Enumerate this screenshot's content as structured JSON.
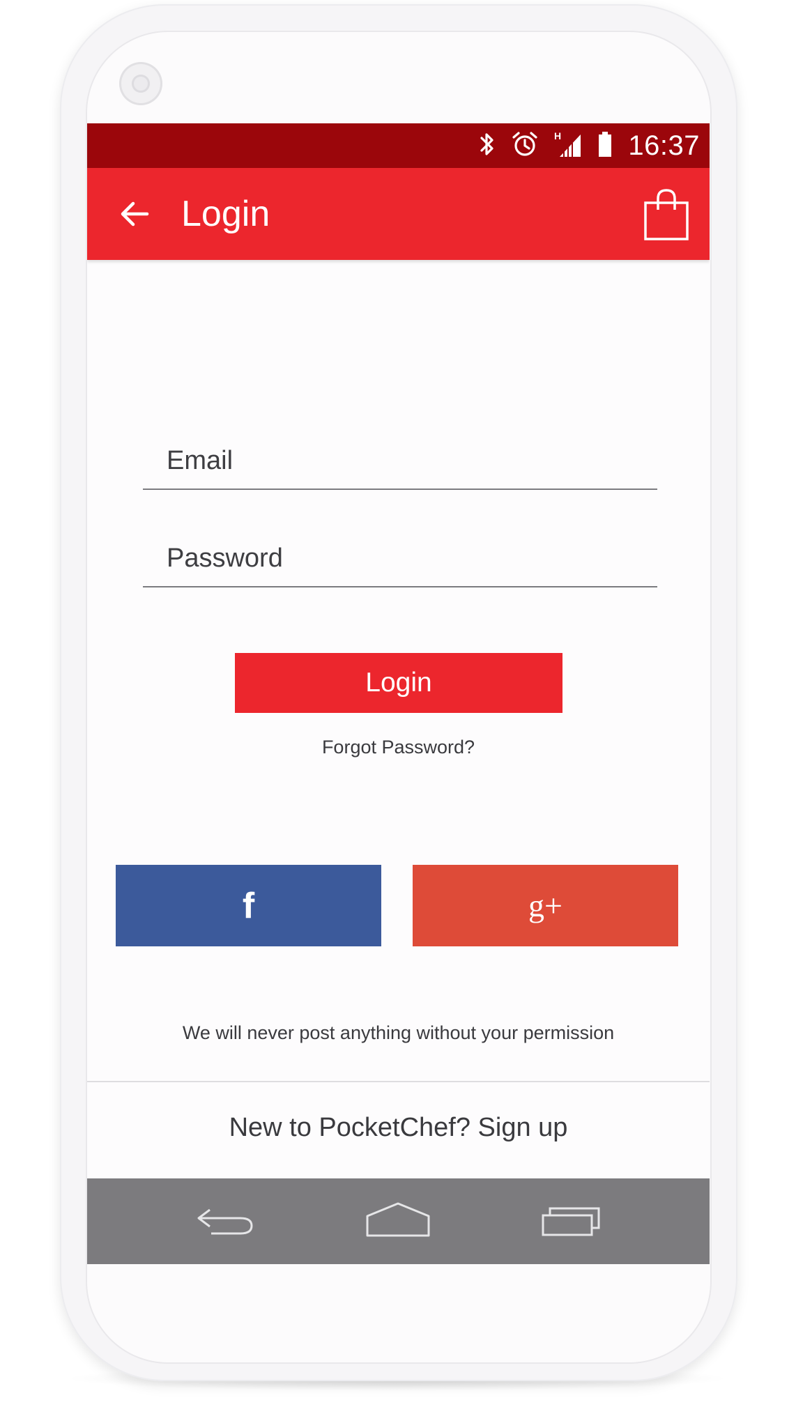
{
  "status_bar": {
    "time": "16:37",
    "icons": [
      "bluetooth-icon",
      "alarm-icon",
      "signal-icon",
      "battery-icon"
    ],
    "network_label": "H"
  },
  "app_bar": {
    "title": "Login",
    "back_icon": "arrow-left-icon",
    "cart_icon": "shopping-bag-icon"
  },
  "form": {
    "email": {
      "placeholder": "Email",
      "value": ""
    },
    "password": {
      "placeholder": "Password",
      "value": ""
    },
    "login_label": "Login",
    "forgot_label": "Forgot Password?"
  },
  "social": {
    "facebook_glyph": "f",
    "google_glyph": "g+",
    "permission_note": "We will never post anything without your permission"
  },
  "footer": {
    "signup_label": "New to PocketChef? Sign up"
  },
  "nav_bar": {
    "icons": [
      "back-nav-icon",
      "home-nav-icon",
      "recents-nav-icon"
    ]
  },
  "colors": {
    "status_bar": "#9b060b",
    "primary": "#ec262d",
    "facebook": "#3c5a9b",
    "google": "#de4b38",
    "nav_bar": "#7c7b7e"
  }
}
